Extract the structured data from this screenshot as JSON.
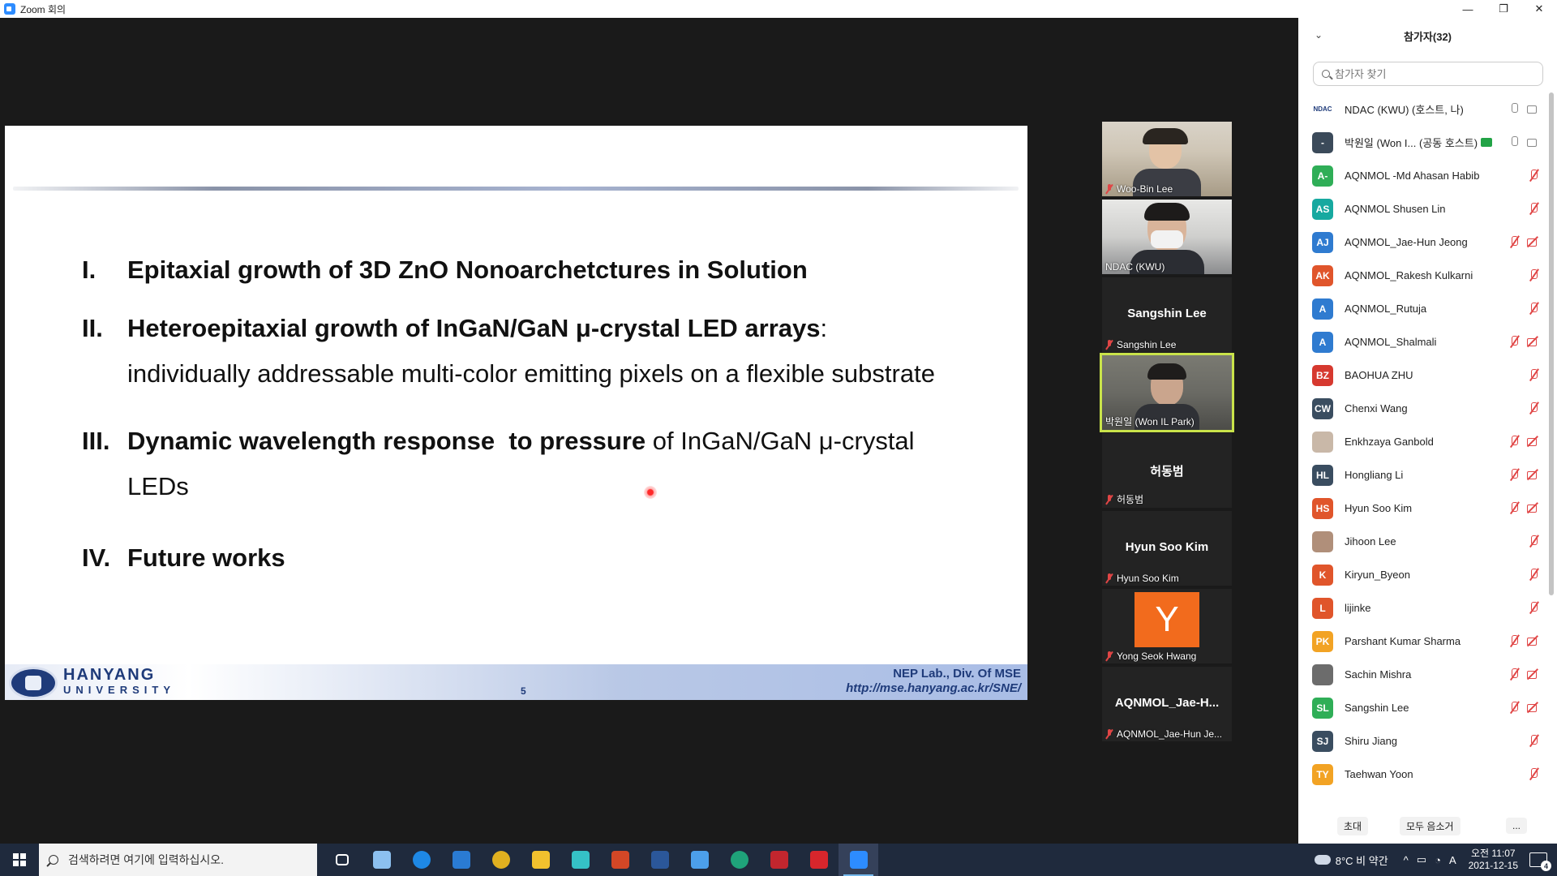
{
  "window": {
    "title": "Zoom 회의",
    "controls": [
      "—",
      "❐",
      "✕"
    ]
  },
  "slide": {
    "items": [
      {
        "num": "I.",
        "bold": "Epitaxial growth of 3D ZnO Nonoarchetctures in Solution",
        "rest": "",
        "cont": ""
      },
      {
        "num": "II.",
        "bold": "Heteroepitaxial growth of InGaN/GaN μ-crystal LED arrays",
        "rest": ":",
        "cont": "individually addressable multi-color emitting pixels on a flexible substrate"
      },
      {
        "num": "III.",
        "bold": "Dynamic wavelength response  to pressure",
        "rest": " of InGaN/GaN μ-crystal",
        "cont": "LEDs"
      },
      {
        "num": "IV.",
        "bold": "Future works",
        "rest": "",
        "cont": ""
      }
    ],
    "footer": {
      "university_line1": "HANYANG",
      "university_line2": "UNIVERSITY",
      "page_number": "5",
      "lab": "NEP Lab., Div. Of MSE",
      "url": "http://mse.hanyang.ac.kr/SNE/"
    }
  },
  "gallery": [
    {
      "name": "Woo-Bin Lee",
      "type": "video",
      "muted": true
    },
    {
      "name": "NDAC (KWU)",
      "type": "video",
      "muted": false
    },
    {
      "name": "Sangshin Lee",
      "center": "Sangshin Lee",
      "type": "name",
      "muted": true
    },
    {
      "name": "박원일 (Won IL Park)",
      "type": "video",
      "muted": false,
      "speaking": true
    },
    {
      "name": "허동범",
      "center": "허동범",
      "type": "name",
      "muted": true
    },
    {
      "name": "Hyun Soo Kim",
      "center": "Hyun Soo Kim",
      "type": "name",
      "muted": true
    },
    {
      "name": "Yong Seok Hwang",
      "avatar_letter": "Y",
      "type": "avatar",
      "muted": true
    },
    {
      "name": "AQNMOL_Jae-Hun Je...",
      "center": "AQNMOL_Jae-H...",
      "type": "name",
      "muted": true
    }
  ],
  "participants_panel": {
    "title": "참가자(32)",
    "search_placeholder": "참가자 찾기",
    "participants": [
      {
        "initials": "NDAC",
        "name": "NDAC (KWU) (호스트, 나)",
        "color": "#ffffff",
        "mic": "on",
        "cam": "on"
      },
      {
        "initials": "-",
        "name": "박원일 (Won I... (공동 호스트)",
        "color": "#3b4a5a",
        "mic": "on",
        "cam": "on",
        "sharing": true
      },
      {
        "initials": "A-",
        "name": "AQNMOL -Md Ahasan Habib",
        "color": "#2fae57",
        "mic": "muted"
      },
      {
        "initials": "AS",
        "name": "AQNMOL Shusen Lin",
        "color": "#17a9a0",
        "mic": "muted"
      },
      {
        "initials": "AJ",
        "name": "AQNMOL_Jae-Hun Jeong",
        "color": "#2f7bd0",
        "mic": "muted",
        "cam": "off"
      },
      {
        "initials": "AK",
        "name": "AQNMOL_Rakesh Kulkarni",
        "color": "#e0552b",
        "mic": "muted"
      },
      {
        "initials": "A",
        "name": "AQNMOL_Rutuja",
        "color": "#2f7bd0",
        "mic": "muted"
      },
      {
        "initials": "A",
        "name": "AQNMOL_Shalmali",
        "color": "#2f7bd0",
        "mic": "muted",
        "cam": "off"
      },
      {
        "initials": "BZ",
        "name": "BAOHUA ZHU",
        "color": "#d6392f",
        "mic": "muted"
      },
      {
        "initials": "CW",
        "name": "Chenxi Wang",
        "color": "#3a4d60",
        "mic": "muted"
      },
      {
        "initials": "",
        "name": "Enkhzaya Ganbold",
        "color": "#c9b8a8",
        "mic": "muted",
        "cam": "off"
      },
      {
        "initials": "HL",
        "name": "Hongliang Li",
        "color": "#3a4d60",
        "mic": "muted",
        "cam": "off"
      },
      {
        "initials": "HS",
        "name": "Hyun Soo Kim",
        "color": "#e0552b",
        "mic": "muted",
        "cam": "off"
      },
      {
        "initials": "",
        "name": "Jihoon Lee",
        "color": "#b08f7a",
        "mic": "muted"
      },
      {
        "initials": "K",
        "name": "Kiryun_Byeon",
        "color": "#e0552b",
        "mic": "muted"
      },
      {
        "initials": "L",
        "name": "lijinke",
        "color": "#e0552b",
        "mic": "muted"
      },
      {
        "initials": "PK",
        "name": "Parshant Kumar Sharma",
        "color": "#f2a324",
        "mic": "muted",
        "cam": "off"
      },
      {
        "initials": "",
        "name": "Sachin Mishra",
        "color": "#6c6c6c",
        "mic": "muted",
        "cam": "off"
      },
      {
        "initials": "SL",
        "name": "Sangshin Lee",
        "color": "#2fae57",
        "mic": "muted",
        "cam": "off"
      },
      {
        "initials": "SJ",
        "name": "Shiru Jiang",
        "color": "#3a4d60",
        "mic": "muted"
      },
      {
        "initials": "TY",
        "name": "Taehwan Yoon",
        "color": "#f2a324",
        "mic": "muted"
      }
    ],
    "bottom_buttons": {
      "invite": "초대",
      "mute_all": "모두 음소거",
      "more": "..."
    }
  },
  "taskbar": {
    "search_placeholder": "검색하려면 여기에 입력하십시오.",
    "apps": [
      {
        "name": "task-view",
        "color": "#ffffff"
      },
      {
        "name": "app-gear",
        "color": "#8cc0ef"
      },
      {
        "name": "edge-legacy",
        "color": "#1e88e5"
      },
      {
        "name": "mail",
        "color": "#2a7bd3"
      },
      {
        "name": "chrome",
        "color": "#e0b020"
      },
      {
        "name": "file-explorer",
        "color": "#f2c12e"
      },
      {
        "name": "feather-app",
        "color": "#35c1c6"
      },
      {
        "name": "powerpoint",
        "color": "#d24726"
      },
      {
        "name": "word",
        "color": "#2b579a"
      },
      {
        "name": "store",
        "color": "#4c9fea"
      },
      {
        "name": "edge",
        "color": "#1fa37a"
      },
      {
        "name": "app-red",
        "color": "#c2262e"
      },
      {
        "name": "acrobat",
        "color": "#d7262c"
      },
      {
        "name": "zoom",
        "color": "#2d8cff",
        "active": true
      }
    ],
    "weather": "8°C  비 약간",
    "ime": "A",
    "time": "오전 11:07",
    "date": "2021-12-15",
    "notifications": "4"
  }
}
